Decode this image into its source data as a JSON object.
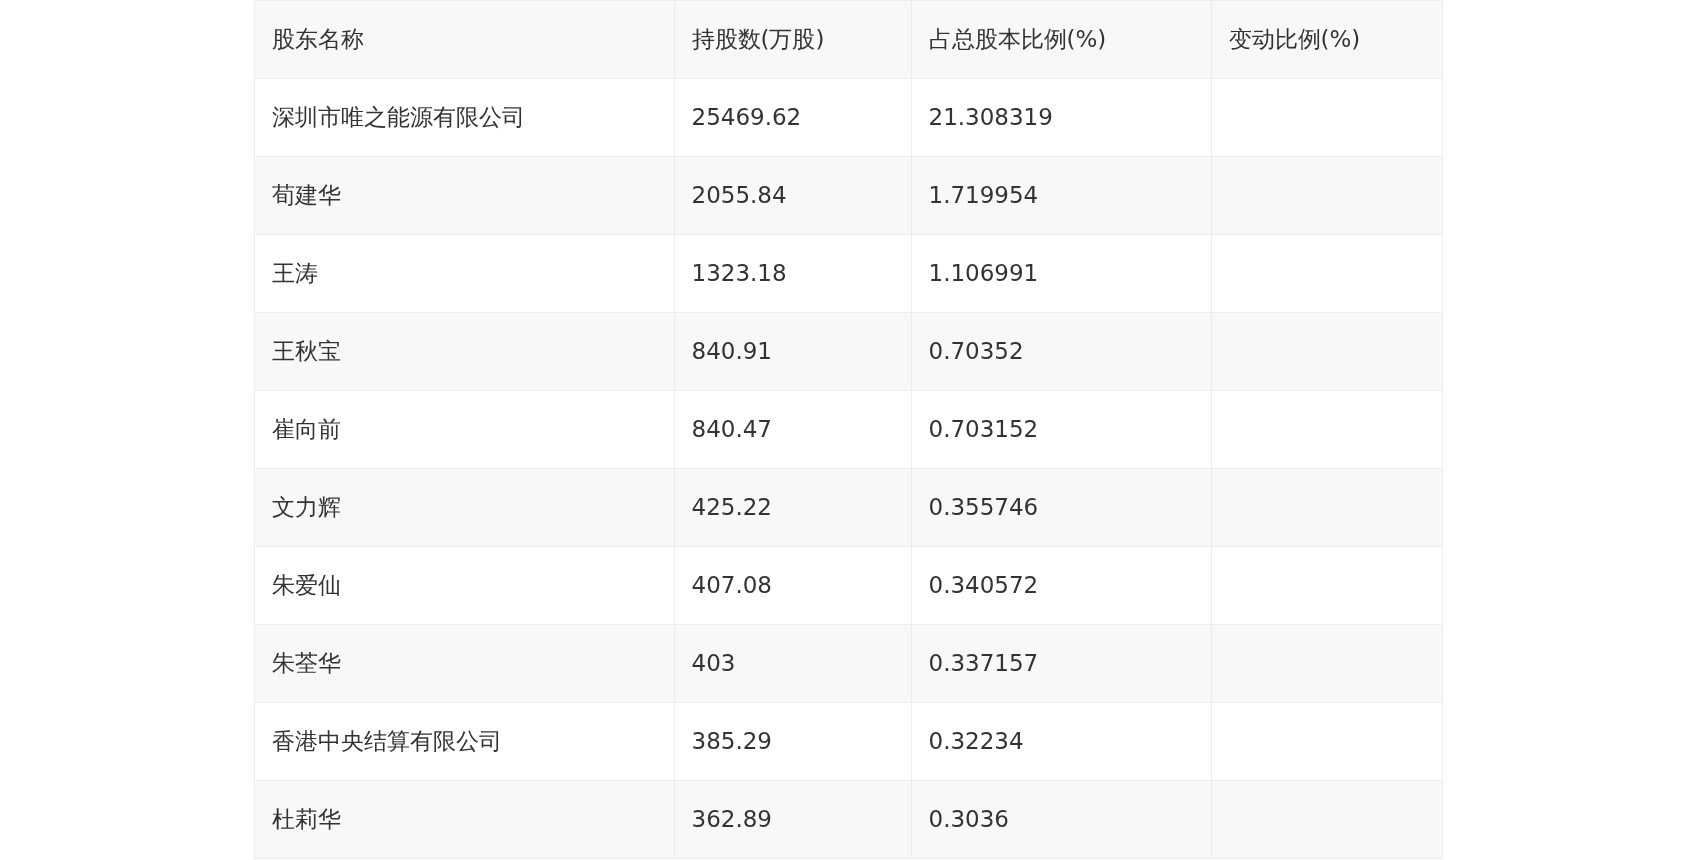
{
  "table": {
    "columns": [
      "股东名称",
      "持股数(万股)",
      "占总股本比例(%)",
      "变动比例(%)"
    ],
    "rows": [
      {
        "name": "深圳市唯之能源有限公司",
        "shares": "25469.62",
        "ratio": "21.308319"
      },
      {
        "name": "荀建华",
        "shares": "2055.84",
        "ratio": "1.719954"
      },
      {
        "name": "王涛",
        "shares": "1323.18",
        "ratio": "1.106991"
      },
      {
        "name": "王秋宝",
        "shares": "840.91",
        "ratio": "0.70352"
      },
      {
        "name": "崔向前",
        "shares": "840.47",
        "ratio": "0.703152"
      },
      {
        "name": "文力辉",
        "shares": "425.22",
        "ratio": "0.355746"
      },
      {
        "name": "朱爱仙",
        "shares": "407.08",
        "ratio": "0.340572"
      },
      {
        "name": "朱荃华",
        "shares": "403",
        "ratio": "0.337157"
      },
      {
        "name": "香港中央结算有限公司",
        "shares": "385.29",
        "ratio": "0.32234"
      },
      {
        "name": "杜莉华",
        "shares": "362.89",
        "ratio": "0.3036"
      }
    ]
  }
}
